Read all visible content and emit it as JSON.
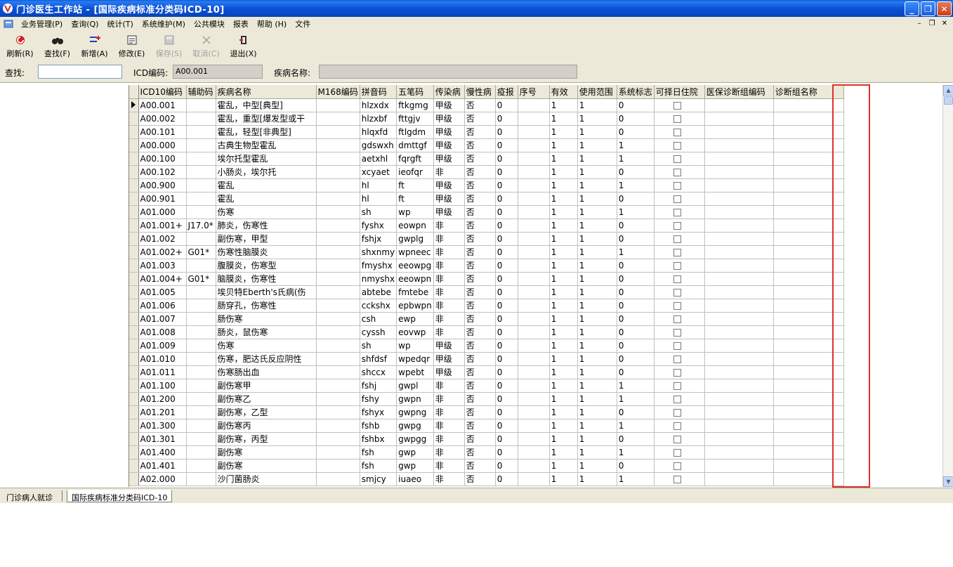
{
  "window": {
    "title": "门诊医生工作站 - [国际疾病标准分类码ICD-10]"
  },
  "menu": [
    "业务管理(P)",
    "查询(Q)",
    "统计(T)",
    "系统维护(M)",
    "公共模块",
    "报表",
    "帮助 (H)",
    "文件"
  ],
  "toolbar": {
    "refresh": "刷新(R)",
    "find": "查找(F)",
    "add": "新增(A)",
    "edit": "修改(E)",
    "save": "保存(S)",
    "cancel": "取消(C)",
    "exit": "退出(X)"
  },
  "search": {
    "find_label": "查找:",
    "find_value": "",
    "icd_label": "ICD编码:",
    "icd_value": "A00.001",
    "name_label": "疾病名称:",
    "name_value": ""
  },
  "columns": [
    "ICD10编码",
    "辅助码",
    "疾病名称",
    "M168编码",
    "拼音码",
    "五笔码",
    "传染病",
    "慢性病",
    "疫报",
    "序号",
    "有效",
    "使用范围",
    "系统标志",
    "可择日住院",
    "医保诊断组编码",
    "诊断组名称"
  ],
  "rows": [
    [
      "A00.001",
      "",
      "霍乱，中型[典型]",
      "",
      "hlzxdx",
      "ftkgmg",
      "甲级",
      "否",
      "0",
      "",
      "1",
      "1",
      "0"
    ],
    [
      "A00.002",
      "",
      "霍乱，重型[爆发型或干",
      "",
      "hlzxbf",
      "fttgjv",
      "甲级",
      "否",
      "0",
      "",
      "1",
      "1",
      "0"
    ],
    [
      "A00.101",
      "",
      "霍乱，轻型[非典型]",
      "",
      "hlqxfd",
      "ftlgdm",
      "甲级",
      "否",
      "0",
      "",
      "1",
      "1",
      "0"
    ],
    [
      "A00.000",
      "",
      "古典生物型霍乱",
      "",
      "gdswxh",
      "dmttgf",
      "甲级",
      "否",
      "0",
      "",
      "1",
      "1",
      "1"
    ],
    [
      "A00.100",
      "",
      "埃尔托型霍乱",
      "",
      "aetxhl",
      "fqrgft",
      "甲级",
      "否",
      "0",
      "",
      "1",
      "1",
      "1"
    ],
    [
      "A00.102",
      "",
      "小肠炎，埃尔托",
      "",
      "xcyaet",
      "ieofqr",
      "非",
      "否",
      "0",
      "",
      "1",
      "1",
      "0"
    ],
    [
      "A00.900",
      "",
      "霍乱",
      "",
      "hl",
      "ft",
      "甲级",
      "否",
      "0",
      "",
      "1",
      "1",
      "1"
    ],
    [
      "A00.901",
      "",
      "霍乱",
      "",
      "hl",
      "ft",
      "甲级",
      "否",
      "0",
      "",
      "1",
      "1",
      "0"
    ],
    [
      "A01.000",
      "",
      "伤寒",
      "",
      "sh",
      "wp",
      "甲级",
      "否",
      "0",
      "",
      "1",
      "1",
      "1"
    ],
    [
      "A01.001+",
      "J17.0*",
      "肺炎，伤寒性",
      "",
      "fyshx",
      "eowpn",
      "非",
      "否",
      "0",
      "",
      "1",
      "1",
      "0"
    ],
    [
      "A01.002",
      "",
      "副伤寒，甲型",
      "",
      "fshjx",
      "gwplg",
      "非",
      "否",
      "0",
      "",
      "1",
      "1",
      "0"
    ],
    [
      "A01.002+",
      "G01*",
      "伤寒性脑膜炎",
      "",
      "shxnmy",
      "wpneec",
      "非",
      "否",
      "0",
      "",
      "1",
      "1",
      "1"
    ],
    [
      "A01.003",
      "",
      "腹膜炎，伤寒型",
      "",
      "fmyshx",
      "eeowpg",
      "非",
      "否",
      "0",
      "",
      "1",
      "1",
      "0"
    ],
    [
      "A01.004+",
      "G01*",
      "脑膜炎，伤寒性",
      "",
      "nmyshx",
      "eeowpn",
      "非",
      "否",
      "0",
      "",
      "1",
      "1",
      "0"
    ],
    [
      "A01.005",
      "",
      "埃贝特Eberth's氏病(伤",
      "",
      "abtebe",
      "fmtebe",
      "非",
      "否",
      "0",
      "",
      "1",
      "1",
      "0"
    ],
    [
      "A01.006",
      "",
      "肠穿孔，伤寒性",
      "",
      "cckshx",
      "epbwpn",
      "非",
      "否",
      "0",
      "",
      "1",
      "1",
      "0"
    ],
    [
      "A01.007",
      "",
      "肠伤寒",
      "",
      "csh",
      "ewp",
      "非",
      "否",
      "0",
      "",
      "1",
      "1",
      "0"
    ],
    [
      "A01.008",
      "",
      "肠炎，鼠伤寒",
      "",
      "cyssh",
      "eovwp",
      "非",
      "否",
      "0",
      "",
      "1",
      "1",
      "0"
    ],
    [
      "A01.009",
      "",
      "伤寒",
      "",
      "sh",
      "wp",
      "甲级",
      "否",
      "0",
      "",
      "1",
      "1",
      "0"
    ],
    [
      "A01.010",
      "",
      "伤寒，肥达氏反应阴性",
      "",
      "shfdsf",
      "wpedqr",
      "甲级",
      "否",
      "0",
      "",
      "1",
      "1",
      "0"
    ],
    [
      "A01.011",
      "",
      "伤寒肠出血",
      "",
      "shccx",
      "wpebt",
      "甲级",
      "否",
      "0",
      "",
      "1",
      "1",
      "0"
    ],
    [
      "A01.100",
      "",
      "副伤寒甲",
      "",
      "fshj",
      "gwpl",
      "非",
      "否",
      "0",
      "",
      "1",
      "1",
      "1"
    ],
    [
      "A01.200",
      "",
      "副伤寒乙",
      "",
      "fshy",
      "gwpn",
      "非",
      "否",
      "0",
      "",
      "1",
      "1",
      "1"
    ],
    [
      "A01.201",
      "",
      "副伤寒，乙型",
      "",
      "fshyx",
      "gwpng",
      "非",
      "否",
      "0",
      "",
      "1",
      "1",
      "0"
    ],
    [
      "A01.300",
      "",
      "副伤寒丙",
      "",
      "fshb",
      "gwpg",
      "非",
      "否",
      "0",
      "",
      "1",
      "1",
      "1"
    ],
    [
      "A01.301",
      "",
      "副伤寒，丙型",
      "",
      "fshbx",
      "gwpgg",
      "非",
      "否",
      "0",
      "",
      "1",
      "1",
      "0"
    ],
    [
      "A01.400",
      "",
      "副伤寒",
      "",
      "fsh",
      "gwp",
      "非",
      "否",
      "0",
      "",
      "1",
      "1",
      "1"
    ],
    [
      "A01.401",
      "",
      "副伤寒",
      "",
      "fsh",
      "gwp",
      "非",
      "否",
      "0",
      "",
      "1",
      "1",
      "0"
    ],
    [
      "A02.000",
      "",
      "沙门菌肠炎",
      "",
      "smjcy",
      "iuaeo",
      "非",
      "否",
      "0",
      "",
      "1",
      "1",
      "1"
    ]
  ],
  "tabs": [
    "门诊病人就诊",
    "国际疾病标准分类码ICD-10"
  ],
  "colors": {
    "title_bar": "#0a52d6",
    "chrome": "#ece9d8",
    "highlight": "#e03030"
  }
}
